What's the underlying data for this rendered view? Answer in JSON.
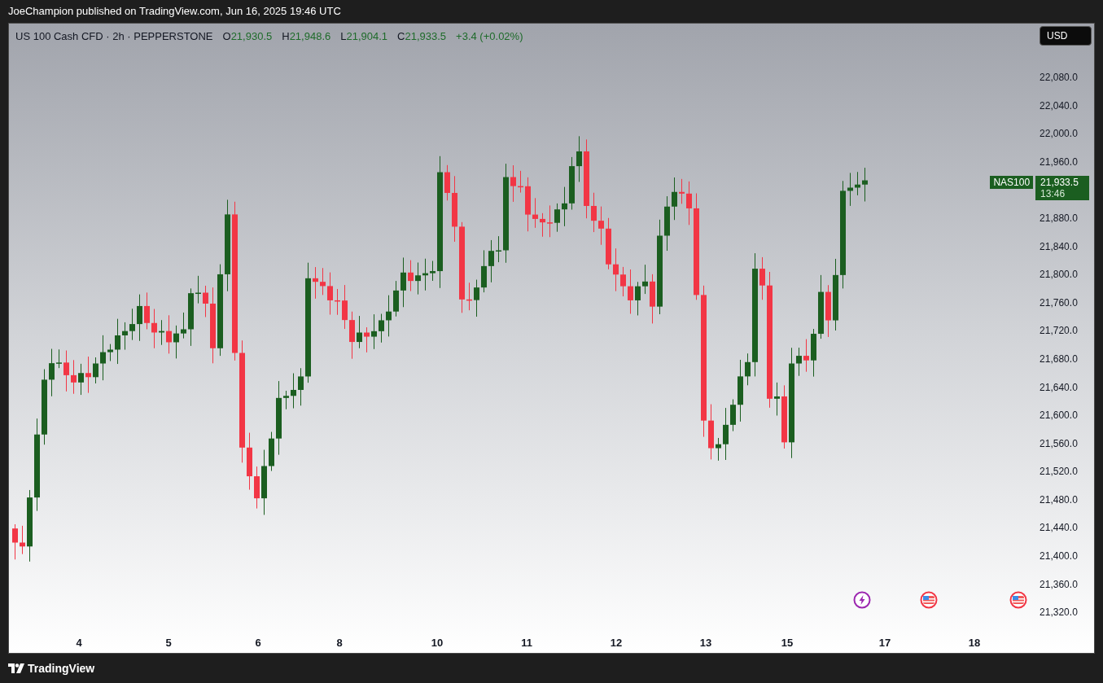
{
  "header": {
    "text": "JoeChampion published on TradingView.com, Jun 16, 2025 19:46 UTC"
  },
  "legend": {
    "symbol": "US 100 Cash CFD · 2h · PEPPERSTONE",
    "values": [
      {
        "label": "O",
        "value": "21,930.5"
      },
      {
        "label": "H",
        "value": "21,948.6"
      },
      {
        "label": "L",
        "value": "21,904.1"
      },
      {
        "label": "C",
        "value": "21,933.5"
      }
    ],
    "change": "+3.4 (+0.02%)"
  },
  "currency_button": "USD",
  "price_axis": {
    "ticks_above": [
      "22,080.0",
      "22,040.0",
      "22,000.0",
      "21,960.0"
    ],
    "ticks_below": [
      "21,880.0",
      "21,840.0",
      "21,800.0",
      "21,760.0",
      "21,720.0",
      "21,680.0",
      "21,640.0",
      "21,600.0",
      "21,560.0",
      "21,520.0",
      "21,480.0",
      "21,440.0",
      "21,400.0",
      "21,360.0",
      "21,320.0"
    ]
  },
  "last_price": {
    "symbol": "NAS100",
    "price": "21,933.5",
    "countdown": "13:46"
  },
  "time_axis": [
    "4",
    "5",
    "6",
    "8",
    "10",
    "11",
    "12",
    "13",
    "15",
    "17",
    "18"
  ],
  "events": [
    {
      "kind": "earnings"
    },
    {
      "kind": "economic"
    },
    {
      "kind": "economic"
    }
  ],
  "footer": {
    "brand": "TradingView"
  }
}
